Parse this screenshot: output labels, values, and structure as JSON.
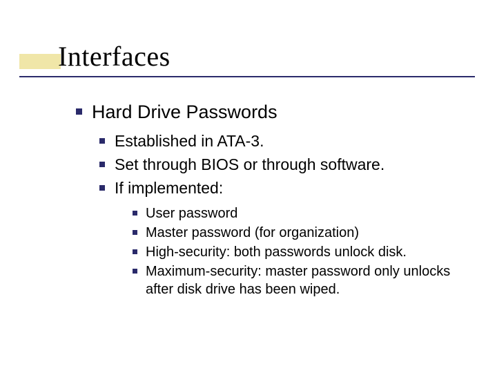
{
  "title": "Interfaces",
  "level1": {
    "item0": "Hard Drive Passwords"
  },
  "level2": {
    "item0": "Established in ATA-3.",
    "item1": "Set through BIOS or through software.",
    "item2": "If implemented:"
  },
  "level3": {
    "item0": "User password",
    "item1": "Master password (for organization)",
    "item2": "High-security: both passwords unlock disk.",
    "item3": "Maximum-security: master password only unlocks after disk drive has been wiped."
  }
}
